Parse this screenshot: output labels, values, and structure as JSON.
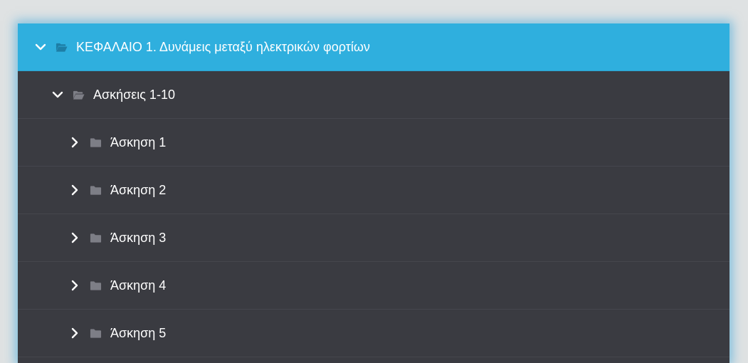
{
  "tree": {
    "chapter": {
      "label": "ΚΕΦΑΛΑΙΟ 1. Δυνάμεις μεταξύ ηλεκτρικών φορτίων",
      "expanded": true
    },
    "group": {
      "label": "Ασκήσεις 1-10",
      "expanded": true
    },
    "items": [
      {
        "label": "Άσκηση 1"
      },
      {
        "label": "Άσκηση 2"
      },
      {
        "label": "Άσκηση 3"
      },
      {
        "label": "Άσκηση 4"
      },
      {
        "label": "Άσκηση 5"
      }
    ]
  },
  "colors": {
    "chapter_bg": "#2fafde",
    "panel_bg": "#3a3b41",
    "page_bg": "#dfe2e3",
    "icon": "#7d7e86"
  },
  "icons": {
    "expanded": "chevron-down-icon",
    "collapsed": "chevron-right-icon",
    "open_folder": "folder-open-icon",
    "closed_folder": "folder-icon"
  }
}
